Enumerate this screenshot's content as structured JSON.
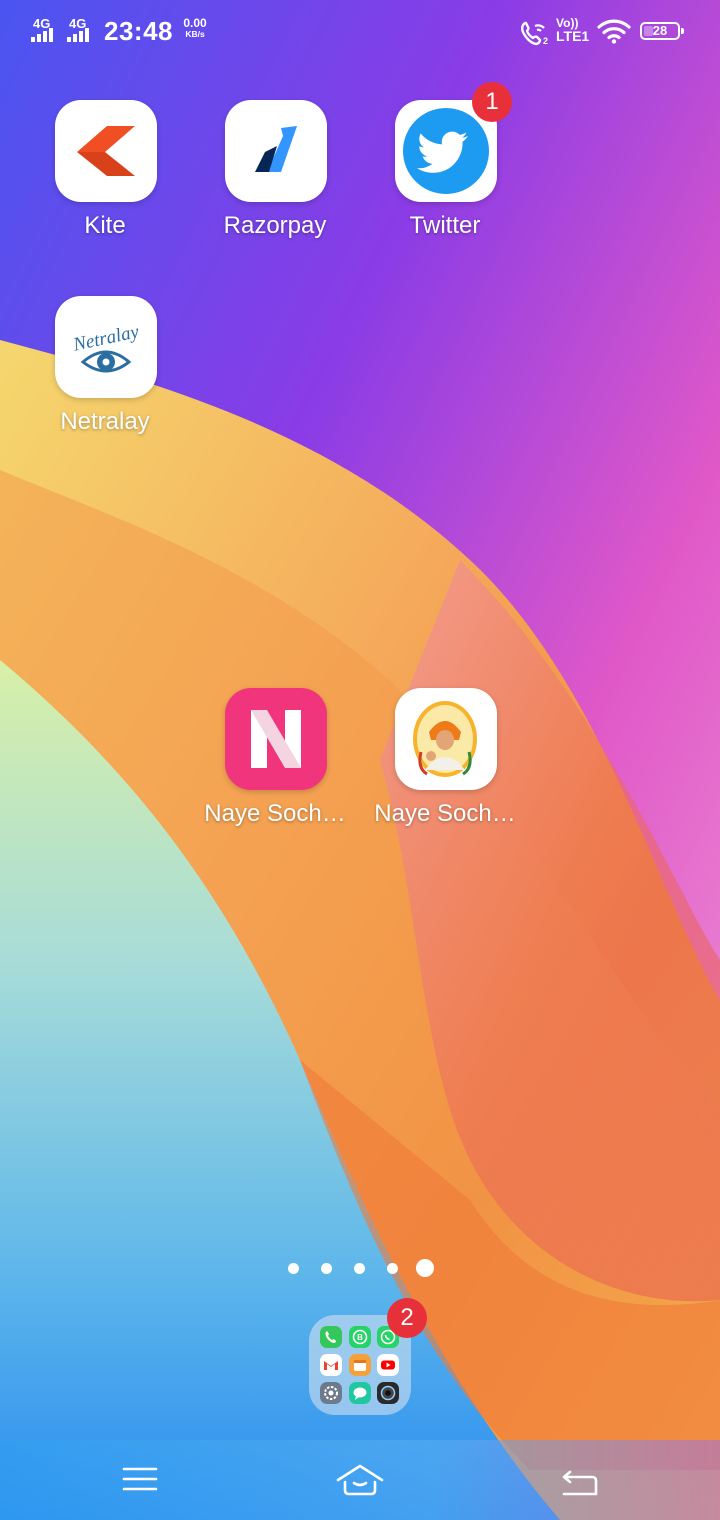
{
  "status_bar": {
    "sim1": "4G",
    "sim2": "4G",
    "time": "23:48",
    "speed_value": "0.00",
    "speed_unit": "KB/s",
    "volte_top": "Vo))",
    "volte_bottom": "LTE1",
    "battery_percent": "28",
    "battery_level": 0.28
  },
  "apps": [
    {
      "label": "Kite"
    },
    {
      "label": "Razorpay"
    },
    {
      "label": "Twitter",
      "badge": "1"
    },
    {
      "label": "Netralay"
    },
    {
      "label": "Naye Soch…"
    },
    {
      "label": "Naye Soch…"
    }
  ],
  "netralay_logo_text": "Netralay",
  "pages": {
    "count": 5,
    "active_index": 4
  },
  "folder": {
    "badge": "2",
    "icons": [
      "phone-icon",
      "whatsapp-business-icon",
      "whatsapp-icon",
      "gmail-icon",
      "calendar-icon",
      "youtube-icon",
      "settings-icon",
      "messages-icon",
      "camera-icon"
    ]
  },
  "nav_bar": {
    "menu": "menu-icon",
    "home": "home-icon",
    "back": "back-icon"
  },
  "colors": {
    "badge": "#e8303a",
    "kite": "#f04e23",
    "twitter": "#1d9bf0",
    "naye_soch_pink": "#f0357d"
  }
}
